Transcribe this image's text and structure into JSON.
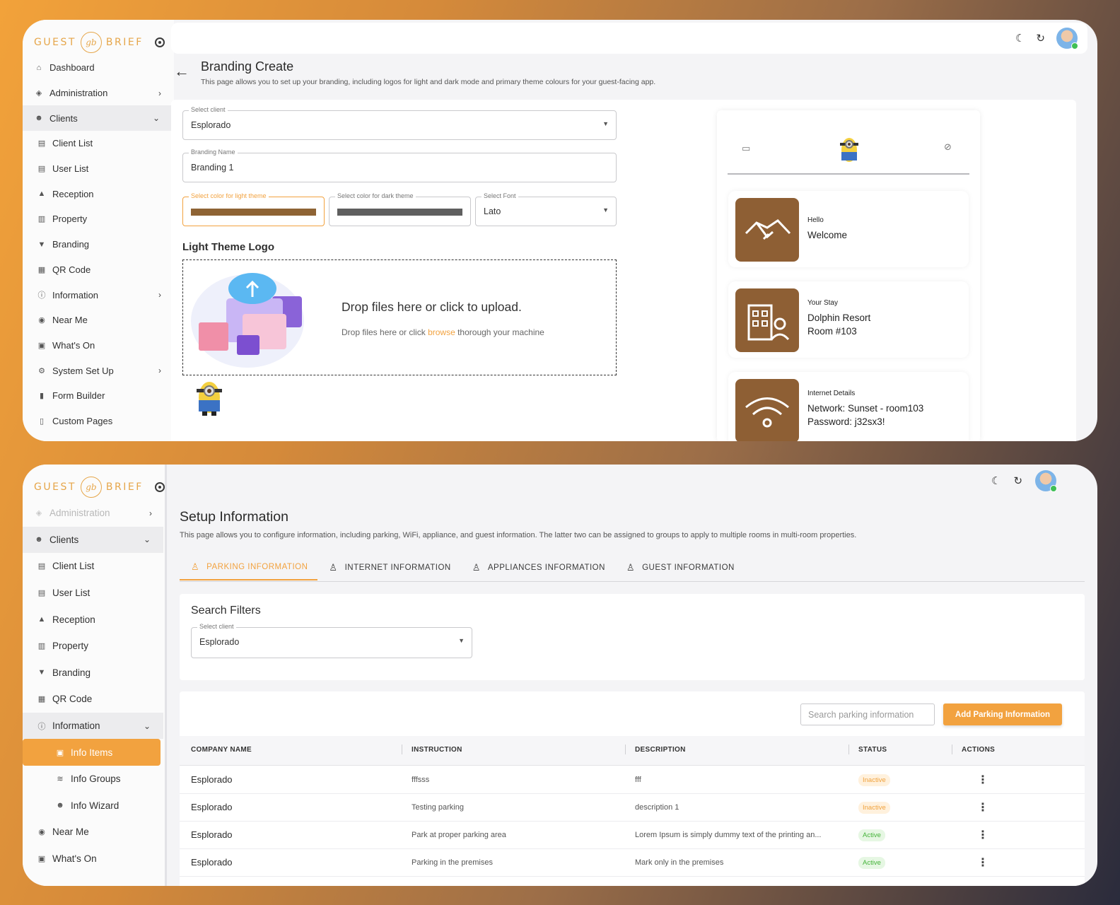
{
  "logo": {
    "left": "GUEST",
    "mark": "gb",
    "right": "BRIEF"
  },
  "top": {
    "sidebar": [
      {
        "label": "Dashboard",
        "icon": "home-icon"
      },
      {
        "label": "Administration",
        "icon": "shield-icon",
        "chevron": "›"
      },
      {
        "label": "Clients",
        "icon": "users-icon",
        "chevron": "⌄"
      },
      {
        "label": "Client List",
        "icon": "list-icon"
      },
      {
        "label": "User List",
        "icon": "list-icon"
      },
      {
        "label": "Reception",
        "icon": "bell-icon"
      },
      {
        "label": "Property",
        "icon": "building-icon"
      },
      {
        "label": "Branding",
        "icon": "paint-icon"
      },
      {
        "label": "QR Code",
        "icon": "qr-icon"
      },
      {
        "label": "Information",
        "icon": "info-icon",
        "chevron": "›"
      },
      {
        "label": "Near Me",
        "icon": "compass-icon"
      },
      {
        "label": "What's On",
        "icon": "calendar-icon"
      },
      {
        "label": "System Set Up",
        "icon": "cog-icon",
        "chevron": "›"
      },
      {
        "label": "Form Builder",
        "icon": "form-icon"
      },
      {
        "label": "Custom Pages",
        "icon": "page-icon"
      }
    ],
    "title": "Branding Create",
    "description": "This page allows you to set up your branding, including logos for light and dark mode and primary theme colours for your guest-facing app.",
    "select_client": {
      "label": "Select client",
      "value": "Esplorado"
    },
    "branding_name": {
      "label": "Branding Name",
      "value": "Branding 1"
    },
    "light_color": {
      "label": "Select color for light theme",
      "value": "#8e6334"
    },
    "dark_color": {
      "label": "Select color for dark theme",
      "value": "#5f5f5f"
    },
    "font": {
      "label": "Select Font",
      "value": "Lato"
    },
    "logo_section": "Light Theme Logo",
    "drop_title": "Drop files here or click to upload.",
    "drop_sub_a": "Drop files here or click",
    "drop_browse": "browse",
    "drop_sub_b": "thorough your machine",
    "preview": [
      {
        "small": "Hello",
        "lines": [
          "Welcome"
        ],
        "icon": "handshake-icon"
      },
      {
        "small": "Your Stay",
        "lines": [
          "Dolphin Resort",
          "Room #103"
        ],
        "icon": "building-person-icon"
      },
      {
        "small": "Internet Details",
        "lines": [
          "Network: Sunset - room103",
          "Password: j32sx3!"
        ],
        "icon": "wifi-icon"
      }
    ],
    "tile_color": "#8e5f34"
  },
  "bottom": {
    "sidebar": [
      {
        "label": "Administration",
        "icon": "shield-icon",
        "chevron": "›",
        "faded": true
      },
      {
        "label": "Clients",
        "icon": "users-icon",
        "chevron": "⌄"
      },
      {
        "label": "Client List",
        "icon": "list-icon"
      },
      {
        "label": "User List",
        "icon": "list-icon"
      },
      {
        "label": "Reception",
        "icon": "bell-icon"
      },
      {
        "label": "Property",
        "icon": "building-icon"
      },
      {
        "label": "Branding",
        "icon": "paint-icon"
      },
      {
        "label": "QR Code",
        "icon": "qr-icon"
      },
      {
        "label": "Information",
        "icon": "info-icon",
        "chevron": "⌄"
      },
      {
        "label": "Info Items",
        "icon": "doc-icon"
      },
      {
        "label": "Info Groups",
        "icon": "layers-icon"
      },
      {
        "label": "Info Wizard",
        "icon": "users-icon"
      },
      {
        "label": "Near Me",
        "icon": "compass-icon"
      },
      {
        "label": "What's On",
        "icon": "calendar-icon"
      }
    ],
    "title": "Setup Information",
    "description": "This page allows you to configure information, including parking, WiFi, appliance, and guest information. The latter two can be assigned to groups to apply to multiple rooms in multi-room properties.",
    "tabs": [
      "PARKING INFORMATION",
      "INTERNET INFORMATION",
      "APPLIANCES INFORMATION",
      "GUEST INFORMATION"
    ],
    "filters_title": "Search Filters",
    "select_client": {
      "label": "Select client",
      "value": "Esplorado"
    },
    "search_placeholder": "Search parking information",
    "add_button": "Add Parking Information",
    "columns": [
      "COMPANY NAME",
      "INSTRUCTION",
      "DESCRIPTION",
      "STATUS",
      "ACTIONS"
    ],
    "rows": [
      {
        "company": "Esplorado",
        "instruction": "fffsss",
        "description": "fff",
        "status": "Inactive"
      },
      {
        "company": "Esplorado",
        "instruction": "Testing parking",
        "description": "description 1",
        "status": "Inactive"
      },
      {
        "company": "Esplorado",
        "instruction": "Park at proper parking area",
        "description": "Lorem Ipsum is simply dummy text of the printing an...",
        "status": "Active"
      },
      {
        "company": "Esplorado",
        "instruction": "Parking in the premises",
        "description": "Mark only in the premises",
        "status": "Active"
      }
    ]
  },
  "accent": "#f2a23f"
}
